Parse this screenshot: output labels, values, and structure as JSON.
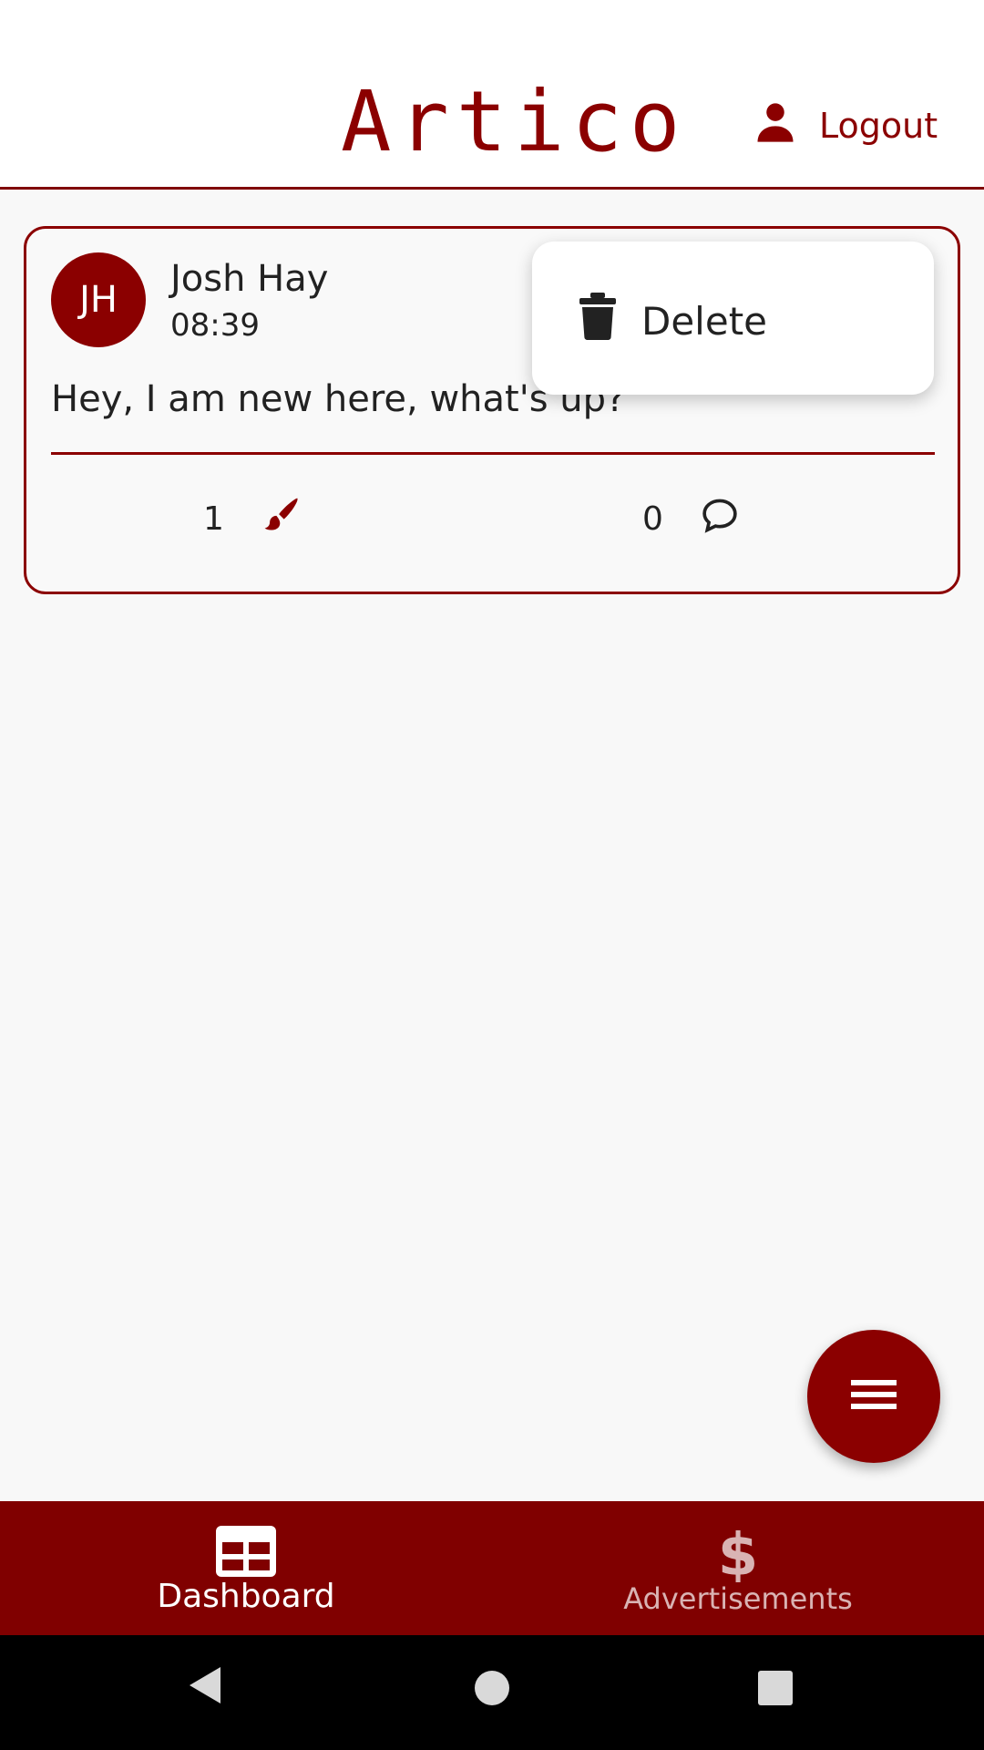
{
  "header": {
    "title": "Artico",
    "logout_label": "Logout"
  },
  "post": {
    "avatar_initials": "JH",
    "author": "Josh Hay",
    "time": "08:39",
    "text": "Hey, I am new here, what's up?",
    "likes_count": "1",
    "comments_count": "0"
  },
  "context_menu": {
    "delete_label": "Delete"
  },
  "bottom_nav": {
    "dashboard_label": "Dashboard",
    "ads_label": "Advertisements"
  },
  "colors": {
    "accent": "#8b0000",
    "nav_bg": "#800000",
    "background": "#f8f8f8"
  },
  "icons": [
    "person-icon",
    "trash-icon",
    "brush-icon",
    "comment-icon",
    "menu-icon",
    "table-icon",
    "dollar-icon",
    "back-icon",
    "home-icon",
    "recents-icon"
  ]
}
